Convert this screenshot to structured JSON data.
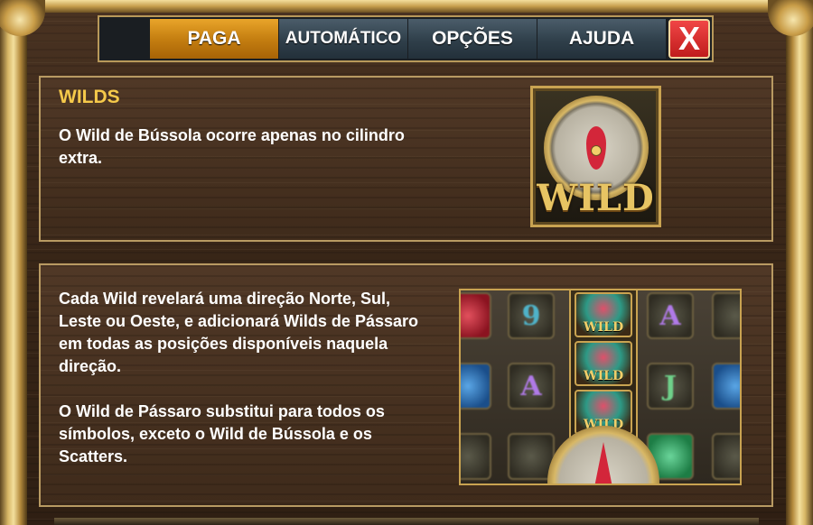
{
  "tabs": [
    {
      "label": "PAGA",
      "active": true
    },
    {
      "label": "AUTOMÁTICO",
      "active": false
    },
    {
      "label": "OPÇÕES",
      "active": false
    },
    {
      "label": "AJUDA",
      "active": false
    }
  ],
  "close_label": "X",
  "wilds_section": {
    "heading": "WILDS",
    "text": "O Wild de Bússola ocorre apenas no cilindro extra.",
    "icon_word": "WILD",
    "icon": "compass-wild-icon"
  },
  "rules_section": {
    "paragraph1": "Cada Wild revelará uma direção Norte, Sul, Leste ou Oeste, e adicionará Wilds de Pássaro em todas as posições disponíveis naquela direção.",
    "paragraph2": "O Wild de Pássaro substitui para todos os símbolos, exceto o Wild de Bússola e os Scatters.",
    "reel_bird_label": "WILD",
    "reel_symbols": [
      "9",
      "A",
      "A",
      "J"
    ]
  },
  "colors": {
    "accent": "#f5c94a",
    "active_tab": "#c57f11",
    "close": "#d62a2a"
  }
}
